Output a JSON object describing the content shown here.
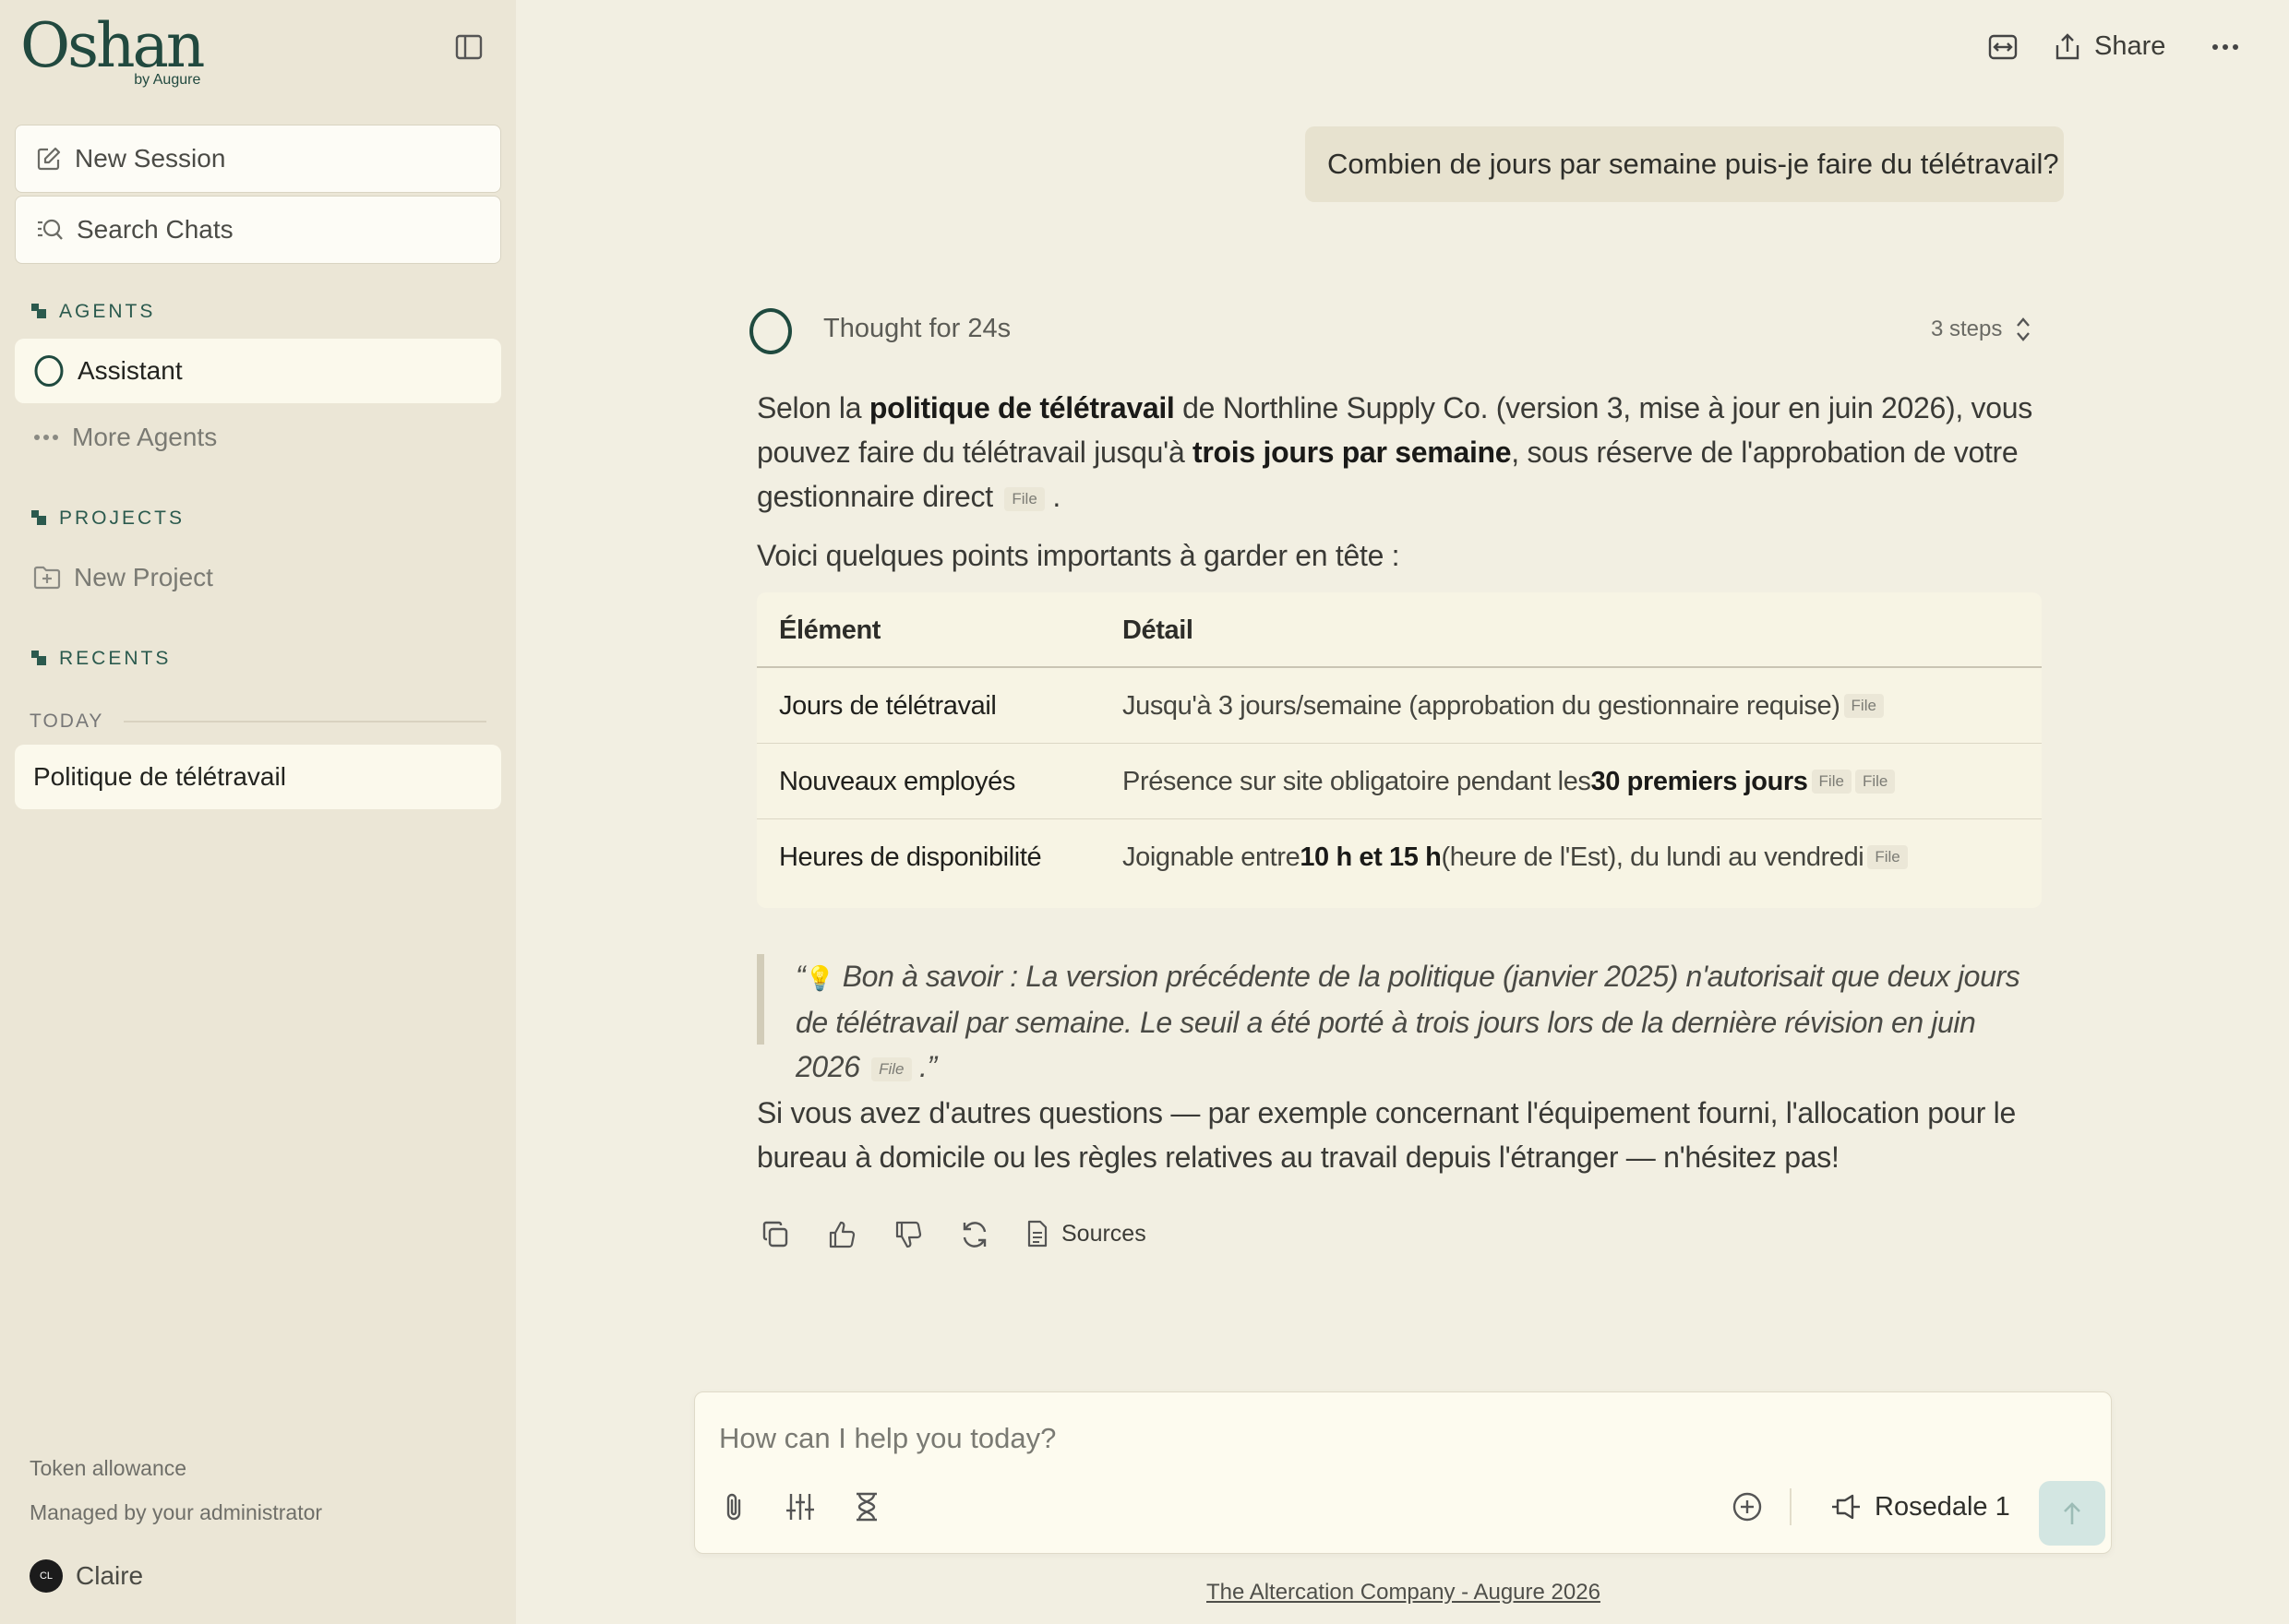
{
  "app": {
    "logo": "Oshan",
    "logo_sub": "by Augure"
  },
  "sidebar": {
    "new_session": "New Session",
    "search_chats": "Search Chats",
    "agents_header": "AGENTS",
    "agents": [
      {
        "label": "Assistant",
        "active": true
      },
      {
        "label": "More Agents"
      }
    ],
    "projects_header": "PROJECTS",
    "new_project": "New Project",
    "recents_header": "RECENTS",
    "today_label": "TODAY",
    "recent_chats": [
      "Politique de télétravail"
    ],
    "token_allowance": "Token allowance",
    "managed_by": "Managed by your administrator",
    "user": {
      "initials": "CL",
      "name": "Claire"
    }
  },
  "topbar": {
    "share_label": "Share"
  },
  "chat": {
    "user_message": "Combien de jours par semaine puis-je faire du télétravail?",
    "thought_label": "Thought for 24s",
    "steps_label": "3 steps",
    "para1": {
      "t1": "Selon la ",
      "b1": "politique de télétravail",
      "t2": " de Northline Supply Co. (version 3, mise à jour en juin 2026), vous pouvez faire du télétravail jusqu'à ",
      "b2": "trois jours par semaine",
      "t3": ", sous réserve de l'approbation de votre gestionnaire direct",
      "end": "."
    },
    "cite_label": "File",
    "para2": "Voici quelques points importants à garder en tête :",
    "table": {
      "headers": [
        "Élément",
        "Détail"
      ],
      "rows": [
        {
          "element": "Jours de télétravail",
          "detail_pre": "Jusqu'à 3 jours/semaine (approbation du gestionnaire requise)",
          "detail_bold": "",
          "detail_post": ""
        },
        {
          "element": "Nouveaux employés",
          "detail_pre": "Présence sur site obligatoire pendant les ",
          "detail_bold": "30 premiers jours",
          "detail_post": ""
        },
        {
          "element": "Heures de disponibilité",
          "detail_pre": "Joignable entre ",
          "detail_bold": "10 h et 15 h",
          "detail_post": " (heure de l'Est), du lundi au vendredi"
        }
      ]
    },
    "quote": {
      "open": "“",
      "bulb": "💡",
      "text": " Bon à savoir : La version précédente de la politique (janvier 2025) n'autorisait que deux jours de télétravail par semaine. Le seuil a été porté à trois jours lors de la dernière révision en juin 2026",
      "close": ".”"
    },
    "para3": "Si vous avez d'autres questions — par exemple concernant l'équipement fourni, l'allocation pour le bureau à domicile ou les règles relatives au travail depuis l'étranger — n'hésitez pas!",
    "sources_label": "Sources"
  },
  "composer": {
    "placeholder": "How can I help you today?",
    "model": "Rosedale 1"
  },
  "footer": {
    "link": "The Altercation Company - Augure 2026"
  },
  "colors": {
    "background": "#f2efe2",
    "sidebar": "#ebe6d6",
    "brand": "#21493f",
    "send_button": "#d3e6e2"
  }
}
